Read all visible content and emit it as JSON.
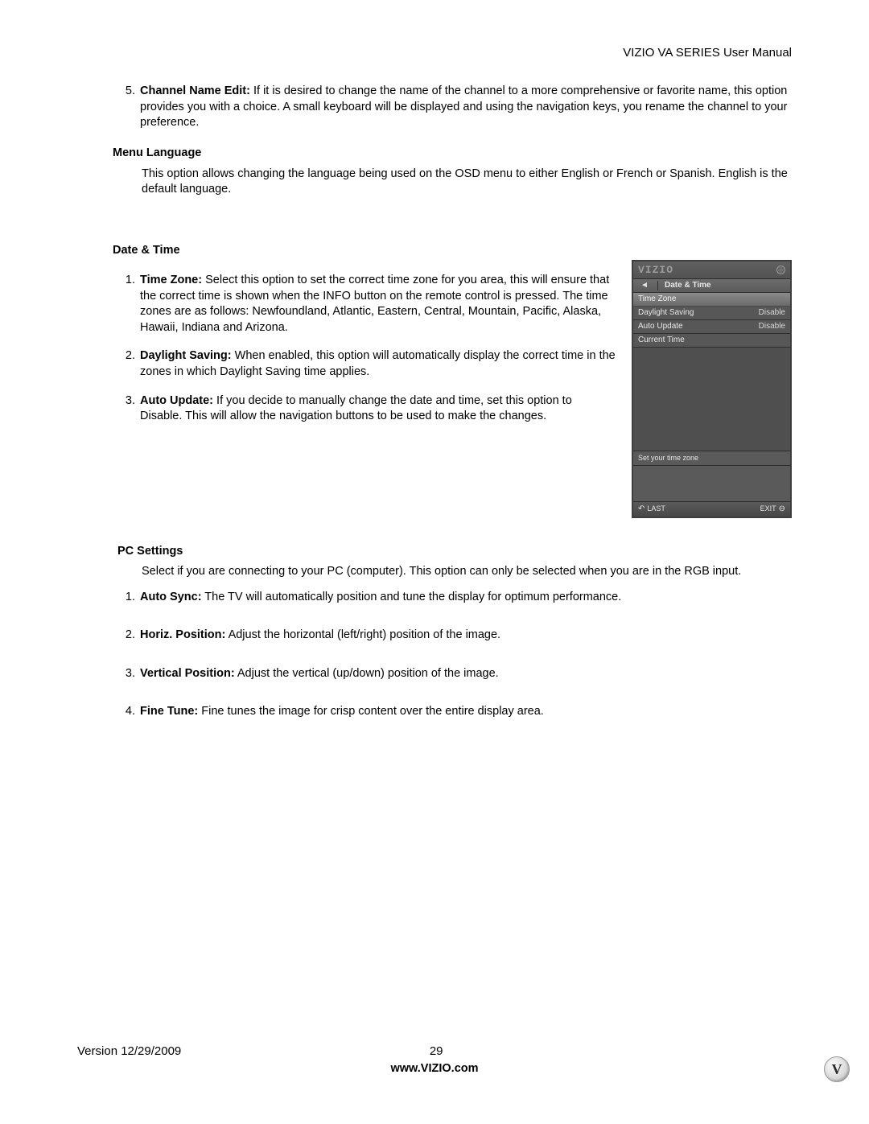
{
  "header": {
    "title": "VIZIO VA SERIES User Manual"
  },
  "channelNameEdit": {
    "num": "5.",
    "label": "Channel Name Edit:",
    "text": " If it is desired to change the name of the channel to a more comprehensive or favorite name, this option provides you with a choice. A small keyboard will be displayed and using the navigation keys, you rename the channel to your preference."
  },
  "menuLanguage": {
    "heading": "Menu Language",
    "text": "This option allows changing the language being used on the OSD menu to either English or French or Spanish. English is the default language."
  },
  "dateTime": {
    "heading": "Date & Time",
    "items": [
      {
        "num": "1.",
        "label": "Time Zone:",
        "text": " Select this option to set the correct time zone for you area, this will ensure that the correct time is shown when the INFO button on the remote control is pressed. The time zones are as follows: Newfoundland, Atlantic, Eastern, Central, Mountain, Pacific, Alaska, Hawaii, Indiana and Arizona."
      },
      {
        "num": "2.",
        "label": "Daylight Saving:",
        "text": " When enabled, this option will automatically display the correct time in the zones in which Daylight Saving time applies."
      },
      {
        "num": "3.",
        "label": "Auto Update:",
        "text": " If you decide to manually change the date and time, set this option to Disable. This will allow the navigation buttons to be used to make the changes."
      }
    ]
  },
  "osd": {
    "logo": "VIZIO",
    "back": "◄",
    "crumbTitle": "Date & Time",
    "rows": [
      {
        "label": "Time Zone",
        "value": ""
      },
      {
        "label": "Daylight Saving",
        "value": "Disable"
      },
      {
        "label": "Auto Update",
        "value": "Disable"
      },
      {
        "label": "Current Time",
        "value": ""
      }
    ],
    "help": "Set your time zone",
    "lastLabel": "LAST",
    "exitLabel": "EXIT"
  },
  "pcSettings": {
    "heading": "PC Settings",
    "intro": "Select if you are connecting to your PC (computer). This option can only be selected when you are in the RGB input.",
    "items": [
      {
        "num": "1.",
        "label": "Auto Sync:",
        "text": " The TV will automatically position and tune the display for optimum performance."
      },
      {
        "num": "2.",
        "label": "Horiz. Position:",
        "text": " Adjust the horizontal (left/right) position of the image."
      },
      {
        "num": "3.",
        "label": "Vertical Position:",
        "text": " Adjust the vertical (up/down) position of the image."
      },
      {
        "num": "4.",
        "label": "Fine Tune:",
        "text": " Fine tunes the image for crisp content over the entire display area."
      }
    ]
  },
  "footer": {
    "version": "Version 12/29/2009",
    "page": "29",
    "url": "www.VIZIO.com",
    "logoLetter": "V"
  }
}
